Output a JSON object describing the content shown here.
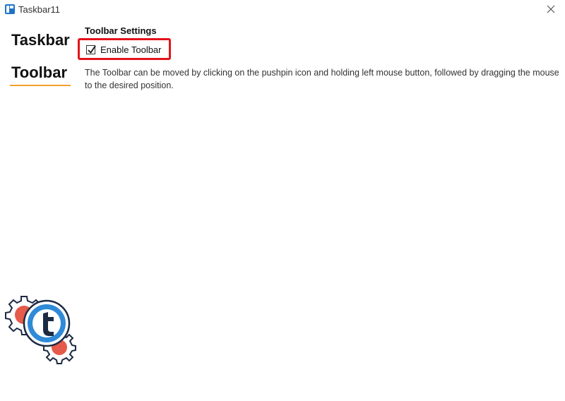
{
  "window": {
    "title": "Taskbar11",
    "icon": "taskbar11-app-icon",
    "close_icon": "close-icon"
  },
  "nav": {
    "items": [
      {
        "label": "Taskbar",
        "selected": false
      },
      {
        "label": "Toolbar",
        "selected": true
      }
    ],
    "accent_color": "#f0a030"
  },
  "main": {
    "section_title": "Toolbar Settings",
    "enable_toolbar": {
      "label": "Enable Toolbar",
      "checked": true
    },
    "highlight_color": "#e3141b",
    "description": "The Toolbar can be moved by clicking on the pushpin icon and holding left mouse button, followed by dragging the mouse to the desired position."
  },
  "logo": {
    "icon": "taskbar11-gears-logo"
  }
}
